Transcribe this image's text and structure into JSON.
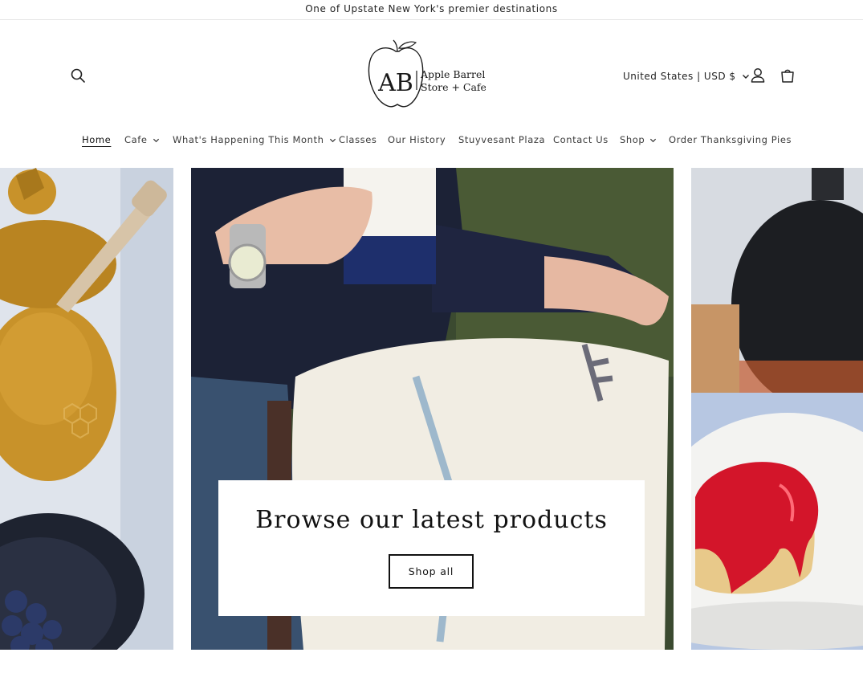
{
  "announcement": {
    "text": "One of Upstate New York's premier destinations"
  },
  "header": {
    "logo": {
      "mark": "AB",
      "line1": "Apple Barrel",
      "line2": "Store + Cafe"
    },
    "country_selector": "United States | USD $"
  },
  "nav": {
    "items": [
      {
        "label": "Home",
        "active": true,
        "dropdown": false
      },
      {
        "label": "Cafe",
        "dropdown": true
      },
      {
        "label": "What's Happening This Month",
        "dropdown": true
      },
      {
        "label": "Classes",
        "dropdown": false
      },
      {
        "label": "Our History",
        "dropdown": false
      },
      {
        "label": "Stuyvesant Plaza",
        "dropdown": false
      },
      {
        "label": "Contact Us",
        "dropdown": false
      },
      {
        "label": "Shop",
        "dropdown": true
      },
      {
        "label": "Order Thanksgiving Pies",
        "dropdown": false
      }
    ]
  },
  "hero": {
    "heading": "Browse our latest products",
    "button_label": "Shop all"
  },
  "icons": [
    "search-icon",
    "account-icon",
    "cart-icon",
    "chevron-down-icon"
  ],
  "colors": {
    "text": "#121212",
    "border": "#e6e6e6",
    "background": "#ffffff"
  }
}
